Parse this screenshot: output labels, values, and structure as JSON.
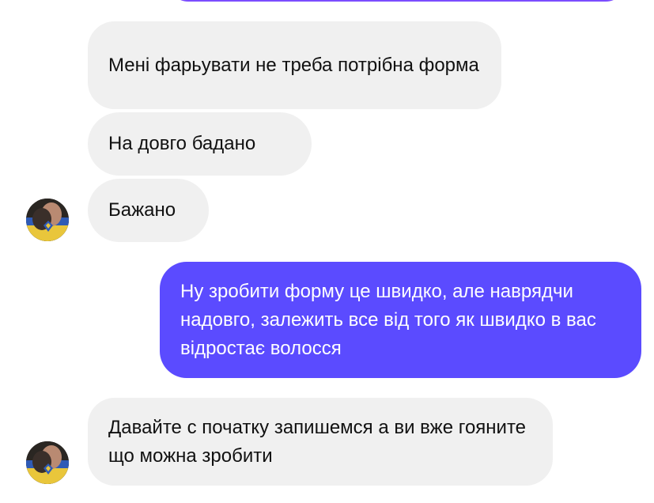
{
  "conversation": {
    "messages": [
      {
        "side": "incoming",
        "text": "Мені фарьувати не треба потрібна форма"
      },
      {
        "side": "incoming",
        "text": "На довго  бадано"
      },
      {
        "side": "incoming",
        "text": "Бажано"
      },
      {
        "side": "outgoing",
        "text": "Ну зробити форму це швидко, але наврядчи надовго, залежить все від того як швидко в вас відростає волосся"
      },
      {
        "side": "incoming",
        "text": "Давайте с початку запишемся а ви вже гояните що можна зробити"
      }
    ]
  },
  "colors": {
    "incoming_bg": "#f0f0f0",
    "outgoing_bg": "#5b4bff",
    "outgoing_text": "#ffffff",
    "incoming_text": "#111111"
  },
  "icons": {
    "avatar": "contact-avatar-photo"
  }
}
